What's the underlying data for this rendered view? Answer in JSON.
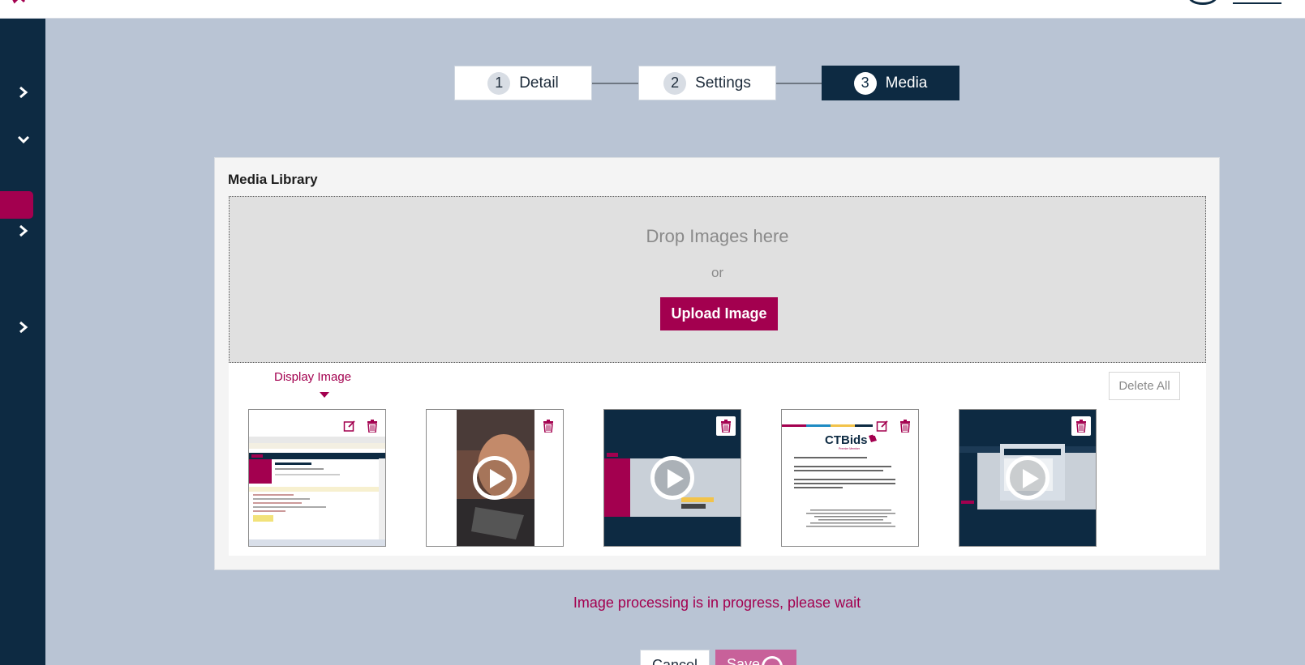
{
  "stepper": {
    "steps": [
      {
        "num": "1",
        "label": "Detail",
        "active": false
      },
      {
        "num": "2",
        "label": "Settings",
        "active": false
      },
      {
        "num": "3",
        "label": "Media",
        "active": true
      }
    ]
  },
  "media_library": {
    "title": "Media Library",
    "drop_text": "Drop Images here",
    "or_text": "or",
    "upload_label": "Upload Image",
    "display_image_label": "Display Image",
    "delete_all_label": "Delete All",
    "thumbnails": [
      {
        "kind": "image",
        "description": "browser screenshot"
      },
      {
        "kind": "video"
      },
      {
        "kind": "video"
      },
      {
        "kind": "image",
        "logo_text": "CTBids",
        "subtitle": "Premier Member"
      },
      {
        "kind": "video"
      }
    ]
  },
  "status_message": "Image processing is in progress, please wait",
  "actions": {
    "cancel_label": "Cancel",
    "save_label": "Save"
  },
  "colors": {
    "brand": "#a3004f",
    "navy": "#0d2a42",
    "page_bg": "#b9c4d4"
  }
}
